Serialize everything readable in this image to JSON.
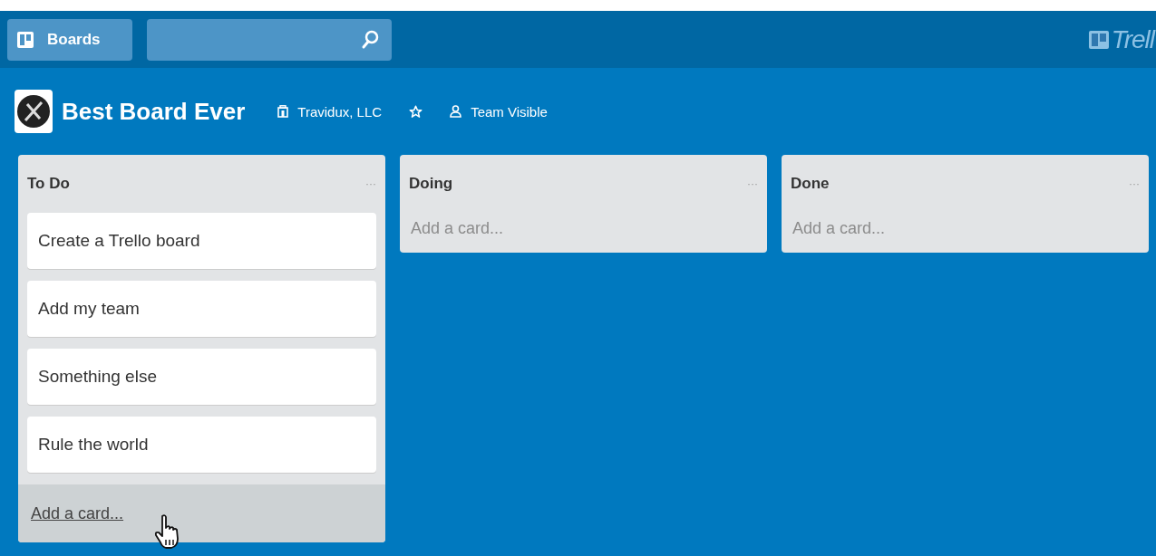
{
  "header": {
    "boards_button": "Boards",
    "logo_text": "Trell"
  },
  "board": {
    "title": "Best Board Ever",
    "team": "Travidux, LLC",
    "starred": false,
    "visibility": "Team Visible"
  },
  "lists": [
    {
      "title": "To Do",
      "menu": "···",
      "cards": [
        "Create a Trello board",
        "Add my team",
        "Something else",
        "Rule the world"
      ],
      "add_card": {
        "label": "Add a card...",
        "hovered": true
      }
    },
    {
      "title": "Doing",
      "menu": "···",
      "add_card": {
        "label": "Add a card...",
        "hovered": false
      }
    },
    {
      "title": "Done",
      "menu": "···",
      "add_card": {
        "label": "Add a card...",
        "hovered": false
      }
    }
  ]
}
